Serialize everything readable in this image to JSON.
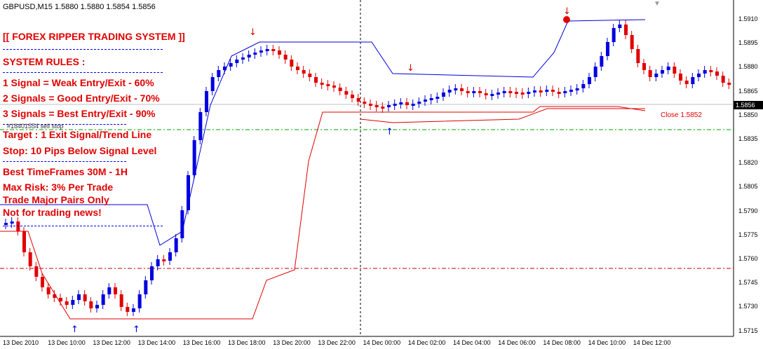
{
  "header": {
    "symbol_text": "GBPUSD,M15  1.5880 1.5880 1.5854 1.5856"
  },
  "rules": {
    "title": "[[ FOREX RIPPER TRADING SYSTEM ]]",
    "system_rules": "SYSTEM RULES :",
    "lines": [
      "1 Signal    = Weak Entry/Exit - 60%",
      "2 Signals = Good Entry/Exit - 70%",
      "3 Signals = Best Entry/Exit - 90%",
      "Target : 1  Exit Signal/Trend Line",
      "Stop: 10 Pips Below Signal Level",
      "Best TimeFrames 30M - 1H",
      "Max Risk: 3% Per Trade",
      "Trade Major Pairs Only",
      "Not for trading news!"
    ],
    "order_note": "#18401554 sell stop"
  },
  "close_label": "Close 1.5852",
  "current_price": "1.5856",
  "price_axis": [
    "1.5910",
    "1.5895",
    "1.5880",
    "1.5865",
    "1.5850",
    "1.5835",
    "1.5820",
    "1.5805",
    "1.5790",
    "1.5775",
    "1.5760",
    "1.5745",
    "1.5730",
    "1.5715"
  ],
  "time_axis": [
    "13 Dec 2010",
    "13 Dec 10:00",
    "13 Dec 12:00",
    "13 Dec 14:00",
    "13 Dec 16:00",
    "13 Dec 18:00",
    "13 Dec 20:00",
    "13 Dec 22:00",
    "14 Dec 00:00",
    "14 Dec 02:00",
    "14 Dec 04:00",
    "14 Dec 06:00",
    "14 Dec 08:00",
    "14 Dec 10:00",
    "14 Dec 12:00"
  ],
  "colors": {
    "bull": "#0000e0",
    "bear": "#e00000",
    "grid_green": "#00a000",
    "grid_red": "#c00000",
    "text_red": "#e00000"
  }
}
